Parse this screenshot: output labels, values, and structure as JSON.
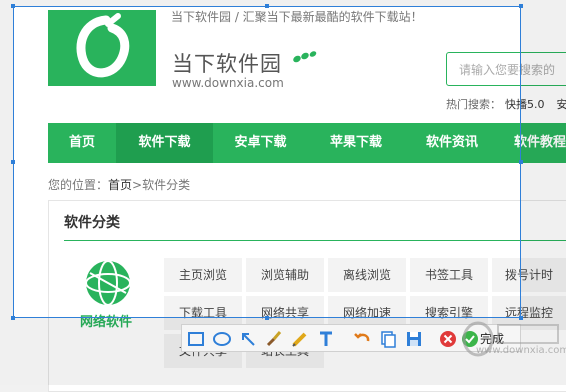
{
  "header": {
    "tagline": "当下软件园 / 汇聚当下最新最酷的软件下载站！",
    "site_name": "当下软件园",
    "domain": "www.downxia.com",
    "search_placeholder": "请输入您要搜索的",
    "hot_label": "热门搜索：",
    "hot_items": [
      "快播5.0",
      "安"
    ]
  },
  "nav": {
    "items": [
      "首页",
      "软件下载",
      "安卓下载",
      "苹果下载",
      "软件资讯",
      "软件教程"
    ],
    "active": "软件下载"
  },
  "breadcrumb": {
    "prefix": "您的位置：",
    "home": "首页",
    "sep": ">",
    "current": "软件分类"
  },
  "category_box": {
    "title": "软件分类",
    "category_label": "网络软件",
    "row1": [
      "主页浏览",
      "浏览辅助",
      "离线浏览",
      "书签工具",
      "拨号计时"
    ],
    "row2": [
      "下载工具",
      "网络共享",
      "网络加速",
      "搜索引擎",
      "远程监控"
    ],
    "row3": [
      "文件共享",
      "站长工具"
    ]
  },
  "screenshot_toolbar": {
    "tools": [
      "rectangle-icon",
      "ellipse-icon",
      "arrow-icon",
      "brush-icon",
      "highlighter-icon",
      "text-icon",
      "undo-icon",
      "copy-icon",
      "save-icon",
      "cancel-icon",
      "confirm-icon"
    ],
    "done_label": "完成"
  },
  "watermark": {
    "text": "www.downxia.com"
  },
  "colors": {
    "brand_green": "#29b35c",
    "nav_active": "#1f9e4f",
    "selection_blue": "#2f7fd8"
  }
}
